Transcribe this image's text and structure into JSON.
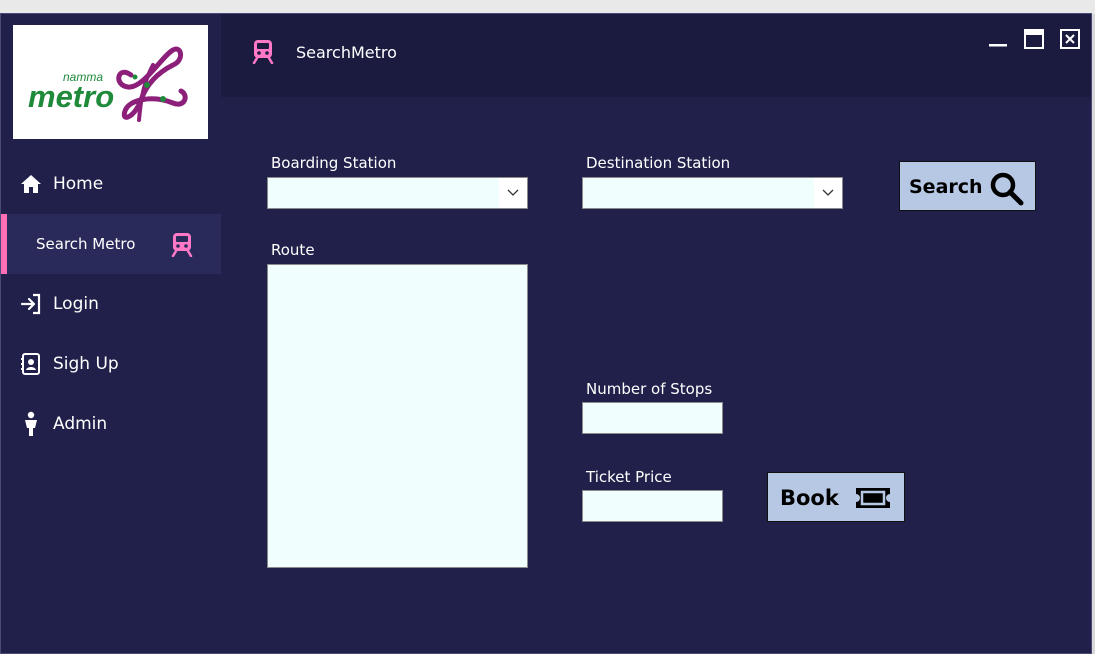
{
  "app": {
    "title": "SearchMetro",
    "logo_text_small": "namma",
    "logo_text_big": "metro"
  },
  "sidebar": {
    "items": [
      {
        "label": "Home",
        "icon": "home-icon"
      },
      {
        "label": "Search Metro",
        "icon": "train-icon"
      },
      {
        "label": "Login",
        "icon": "login-icon"
      },
      {
        "label": "Sigh Up",
        "icon": "contact-card-icon"
      },
      {
        "label": "Admin",
        "icon": "person-icon"
      }
    ]
  },
  "form": {
    "boarding_label": "Boarding Station",
    "boarding_value": "",
    "destination_label": "Destination Station",
    "destination_value": "",
    "route_label": "Route",
    "route_value": "",
    "stops_label": "Number of Stops",
    "stops_value": "",
    "price_label": "Ticket Price",
    "price_value": ""
  },
  "buttons": {
    "search": "Search",
    "book": "Book"
  },
  "colors": {
    "background": "#20204a",
    "topbar": "#1b1b40",
    "accent": "#ff6fb5",
    "button": "#b7c8e4",
    "field": "#f0fffe"
  }
}
